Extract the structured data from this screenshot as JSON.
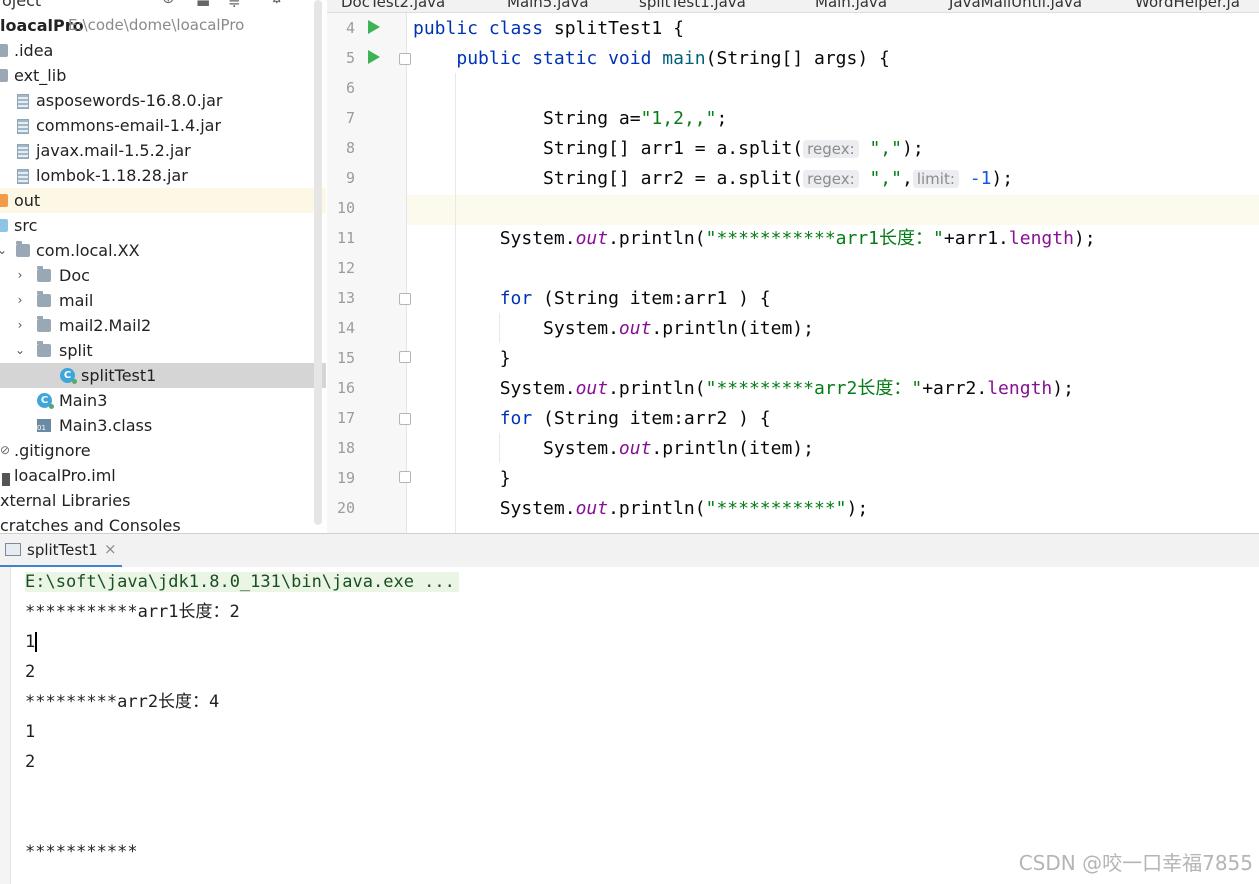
{
  "project": {
    "header_left": "oject",
    "root": {
      "name": "loacalPro",
      "path": "E:\\code\\dome\\loacalPro"
    },
    "items": [
      {
        "label": ".idea"
      },
      {
        "label": "ext_lib"
      },
      {
        "label": "asposewords-16.8.0.jar"
      },
      {
        "label": "commons-email-1.4.jar"
      },
      {
        "label": "javax.mail-1.5.2.jar"
      },
      {
        "label": "lombok-1.18.28.jar"
      },
      {
        "label": "out"
      },
      {
        "label": "src"
      },
      {
        "label": "com.local.XX"
      },
      {
        "label": "Doc"
      },
      {
        "label": "mail"
      },
      {
        "label": "mail2.Mail2"
      },
      {
        "label": "split"
      },
      {
        "label": "splitTest1"
      },
      {
        "label": "Main3"
      },
      {
        "label": "Main3.class"
      },
      {
        "label": ".gitignore"
      },
      {
        "label": "loacalPro.iml"
      },
      {
        "label": "xternal Libraries"
      },
      {
        "label": "cratches and Consoles"
      }
    ],
    "class_icon_letter": "C",
    "bin_icon_text": "01"
  },
  "tabs": [
    "DocTest2.java",
    "Main5.java",
    "splitTest1.java",
    "Main.java",
    "JavaMailUntil.java",
    "WordHelper.ja"
  ],
  "editor": {
    "line_numbers": [
      "4",
      "5",
      "6",
      "7",
      "8",
      "9",
      "10",
      "11",
      "12",
      "13",
      "14",
      "15",
      "16",
      "17",
      "18",
      "19",
      "20"
    ],
    "hints": {
      "regex": "regex:",
      "limit": "limit:"
    },
    "code": {
      "l4": {
        "kw": "public class",
        "rest": " splitTest1 {"
      },
      "l5": {
        "kw": "public static void",
        "mname": "main",
        "rest": "(String[] args) {"
      },
      "l7": {
        "pre": "String a=",
        "str": "\"1,2,,\"",
        "post": ";"
      },
      "l8": {
        "pre": "String[] arr1 = a.split(",
        "str": "\",\"",
        "post": ");"
      },
      "l9": {
        "pre": "String[] arr2 = a.split(",
        "str": "\",\"",
        "sep": ",",
        "num": "-1",
        "post": ");"
      },
      "l11": {
        "pre": "System.",
        "out": "out",
        "mid": ".println(",
        "str": "\"***********arr1长度：\"",
        "plus": "+arr1.",
        "fld": "length",
        "post": ");"
      },
      "l13": {
        "kw": "for",
        "rest": " (String item:arr1 ) {"
      },
      "l14": {
        "pre": "System.",
        "out": "out",
        "post": ".println(item);"
      },
      "l15": {
        "text": "}"
      },
      "l16": {
        "pre": "System.",
        "out": "out",
        "mid": ".println(",
        "str": "\"*********arr2长度：\"",
        "plus": "+arr2.",
        "fld": "length",
        "post": ");"
      },
      "l17": {
        "kw": "for",
        "rest": " (String item:arr2 ) {"
      },
      "l18": {
        "pre": "System.",
        "out": "out",
        "post": ".println(item);"
      },
      "l19": {
        "text": "}"
      },
      "l20": {
        "pre": "System.",
        "out": "out",
        "mid": ".println(",
        "str": "\"***********\"",
        "post": ");"
      }
    }
  },
  "run": {
    "tab_title": "splitTest1",
    "close": "×",
    "command": "E:\\soft\\java\\jdk1.8.0_131\\bin\\java.exe ...",
    "output": [
      "***********arr1长度：2",
      "1",
      "2",
      "*********arr2长度：4",
      "1",
      "2",
      "",
      "",
      "***********"
    ]
  },
  "watermark": "CSDN @咬一口幸福7855"
}
